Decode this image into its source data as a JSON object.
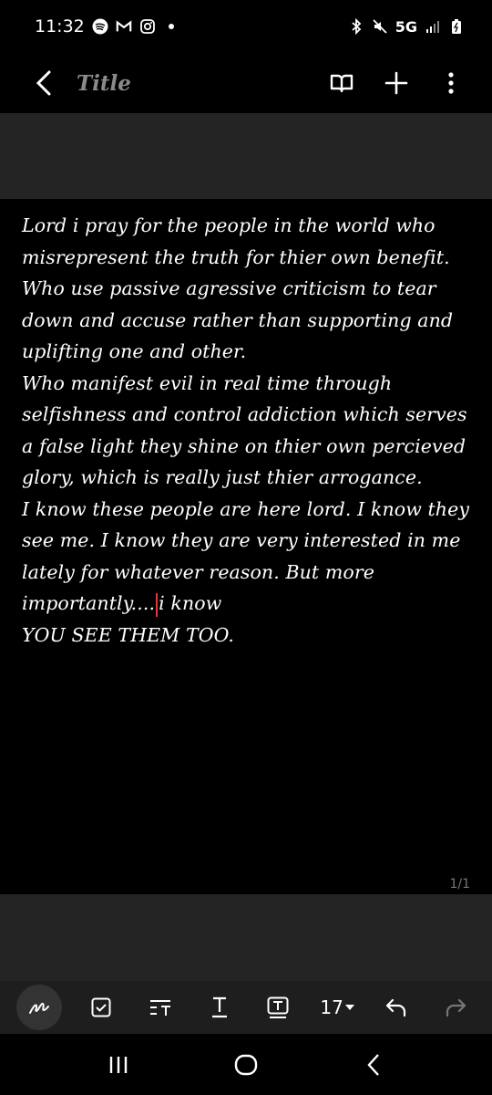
{
  "status": {
    "time": "11:32",
    "network": "5G"
  },
  "appbar": {
    "title": "Title"
  },
  "note": {
    "lines": [
      "Lord i pray for the people in the world who misrepresent the truth for thier own benefit.",
      "Who use passive agressive criticism to tear down and accuse rather than supporting and uplifting one and other.",
      "Who manifest evil in real time through selfishness and control addiction which serves a false light they shine on thier own percieved glory, which is really just thier arrogance.",
      "I know these people are here lord. I know they see me. I know they are very interested in me lately for whatever reason. But more importantly....",
      "i know",
      "YOU SEE THEM TOO."
    ]
  },
  "page_indicator": "1/1",
  "toolbar": {
    "font_size": "17"
  },
  "colors": {
    "background": "#000000",
    "band": "#242424",
    "cursor": "#e53935"
  }
}
